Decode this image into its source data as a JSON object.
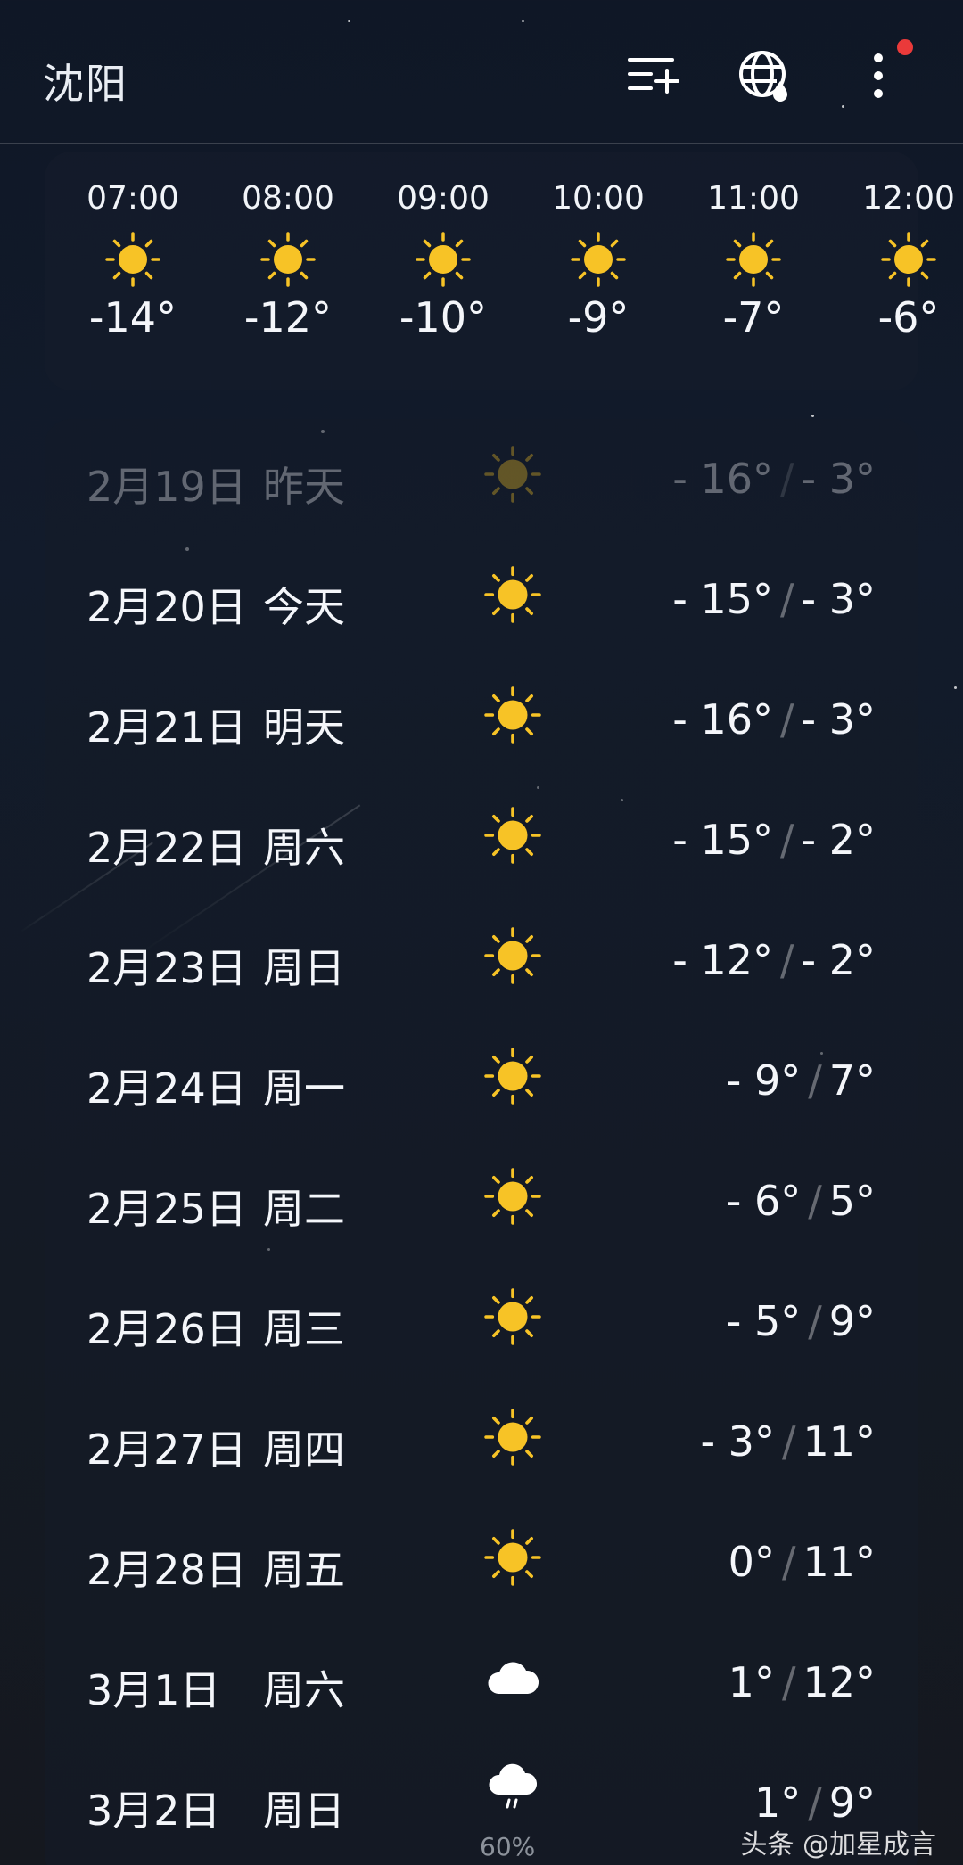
{
  "header": {
    "city": "沈阳"
  },
  "hourly": [
    {
      "time": "07:00",
      "temp": "-14°",
      "icon": "sun-icon"
    },
    {
      "time": "08:00",
      "temp": "-12°",
      "icon": "sun-icon"
    },
    {
      "time": "09:00",
      "temp": "-10°",
      "icon": "sun-icon"
    },
    {
      "time": "10:00",
      "temp": "-9°",
      "icon": "sun-icon"
    },
    {
      "time": "11:00",
      "temp": "-7°",
      "icon": "sun-icon"
    },
    {
      "time": "12:00",
      "temp": "-6°",
      "icon": "sun-icon"
    }
  ],
  "daily": [
    {
      "date": "2月19日",
      "weekday": "昨天",
      "low": "- 16°",
      "high": "- 3°",
      "icon": "sun-icon",
      "past": true
    },
    {
      "date": "2月20日",
      "weekday": "今天",
      "low": "- 15°",
      "high": "- 3°",
      "icon": "sun-icon"
    },
    {
      "date": "2月21日",
      "weekday": "明天",
      "low": "- 16°",
      "high": "- 3°",
      "icon": "sun-icon"
    },
    {
      "date": "2月22日",
      "weekday": "周六",
      "low": "- 15°",
      "high": "- 2°",
      "icon": "sun-icon"
    },
    {
      "date": "2月23日",
      "weekday": "周日",
      "low": "- 12°",
      "high": "- 2°",
      "icon": "sun-icon"
    },
    {
      "date": "2月24日",
      "weekday": "周一",
      "low": "- 9°",
      "high": "7°",
      "icon": "sun-icon"
    },
    {
      "date": "2月25日",
      "weekday": "周二",
      "low": "- 6°",
      "high": "5°",
      "icon": "sun-icon"
    },
    {
      "date": "2月26日",
      "weekday": "周三",
      "low": "- 5°",
      "high": "9°",
      "icon": "sun-icon"
    },
    {
      "date": "2月27日",
      "weekday": "周四",
      "low": "- 3°",
      "high": "11°",
      "icon": "sun-icon"
    },
    {
      "date": "2月28日",
      "weekday": "周五",
      "low": "0°",
      "high": "11°",
      "icon": "sun-icon"
    },
    {
      "date": "3月1日",
      "weekday": "周六",
      "low": "1°",
      "high": "12°",
      "icon": "cloud-icon"
    },
    {
      "date": "3月2日",
      "weekday": "周日",
      "low": "1°",
      "high": "9°",
      "icon": "rain-cloud-icon",
      "precip": "60%"
    }
  ],
  "separator": "/",
  "watermark": "头条 @加星成言",
  "colors": {
    "sun": "#f7c326",
    "badge": "#ea3a3a"
  }
}
